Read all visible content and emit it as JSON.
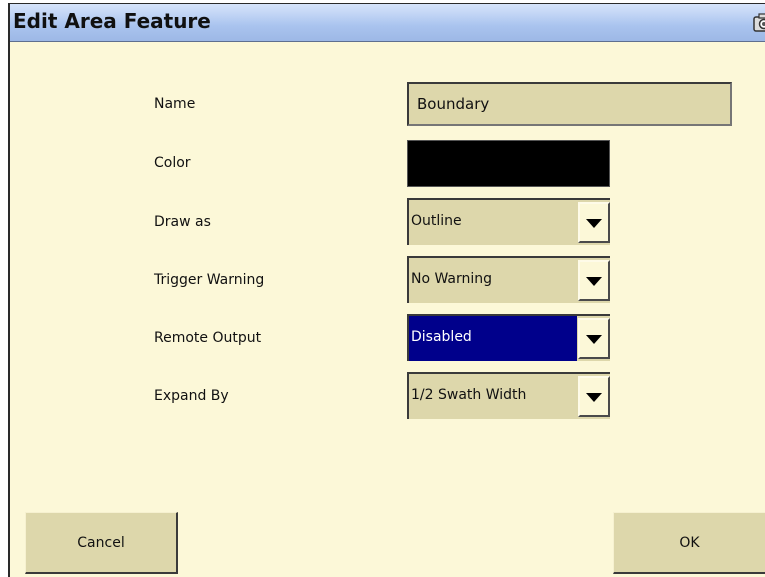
{
  "window": {
    "title": "Edit Area Feature",
    "title_icon": "camera-icon",
    "title_bar_color": "#a9c3ee",
    "background_color": "#fcf8d8"
  },
  "form": {
    "name": {
      "label": "Name",
      "value": "Boundary"
    },
    "color": {
      "label": "Color",
      "value": "#000000"
    },
    "draw_as": {
      "label": "Draw as",
      "value": "Outline"
    },
    "trigger_warning": {
      "label": "Trigger Warning",
      "value": "No Warning"
    },
    "remote_output": {
      "label": "Remote Output",
      "value": "Disabled",
      "highlight_color": "#00008b"
    },
    "expand_by": {
      "label": "Expand By",
      "value": "1/2 Swath Width"
    }
  },
  "buttons": {
    "cancel_label": "Cancel",
    "ok_label": "OK"
  }
}
